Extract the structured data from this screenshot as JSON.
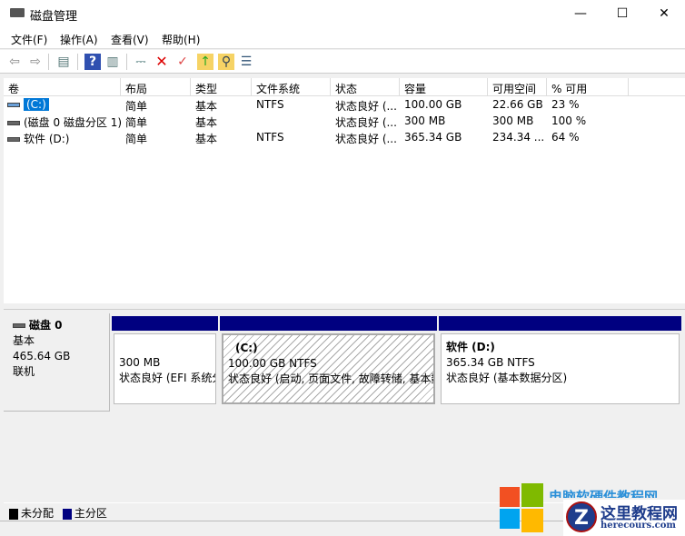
{
  "window": {
    "title": "磁盘管理",
    "minimize": "—",
    "maximize": "☐",
    "close": "✕"
  },
  "menu": [
    "文件(F)",
    "操作(A)",
    "查看(V)",
    "帮助(H)"
  ],
  "toolbar": {
    "back": "⇦",
    "forward": "⇨",
    "console": "▤",
    "help": "?",
    "view": "▥",
    "connect": "⎓",
    "delete": "✕",
    "properties": "✓",
    "up": "↑",
    "search": "⚲",
    "list": "☰"
  },
  "columns": [
    "卷",
    "布局",
    "类型",
    "文件系统",
    "状态",
    "容量",
    "可用空间",
    "% 可用"
  ],
  "rows": [
    [
      "(C:)",
      "简单",
      "基本",
      "NTFS",
      "状态良好 (...",
      "100.00 GB",
      "22.66 GB",
      "23 %"
    ],
    [
      "(磁盘 0 磁盘分区 1)",
      "简单",
      "基本",
      "",
      "状态良好 (...",
      "300 MB",
      "300 MB",
      "100 %"
    ],
    [
      "软件 (D:)",
      "简单",
      "基本",
      "NTFS",
      "状态良好 (...",
      "365.34 GB",
      "234.34 ...",
      "64 %"
    ]
  ],
  "disk": {
    "name": "磁盘 0",
    "type": "基本",
    "size": "465.64 GB",
    "status": "联机"
  },
  "partitions": [
    {
      "label": "",
      "size": "300 MB",
      "status": "状态良好 (EFI 系统分区)"
    },
    {
      "label": "(C:)",
      "size": "100.00 GB NTFS",
      "status": "状态良好 (启动, 页面文件, 故障转储, 基本数据分区)"
    },
    {
      "label": "软件  (D:)",
      "size": "365.34 GB NTFS",
      "status": "状态良好 (基本数据分区)"
    }
  ],
  "legend": [
    {
      "label": "未分配",
      "color": "#000000"
    },
    {
      "label": "主分区",
      "color": "#000080"
    }
  ],
  "watermark": {
    "text1": "电脑软硬件教程网",
    "text2": "这里教程网",
    "text3": "herecours.com"
  }
}
